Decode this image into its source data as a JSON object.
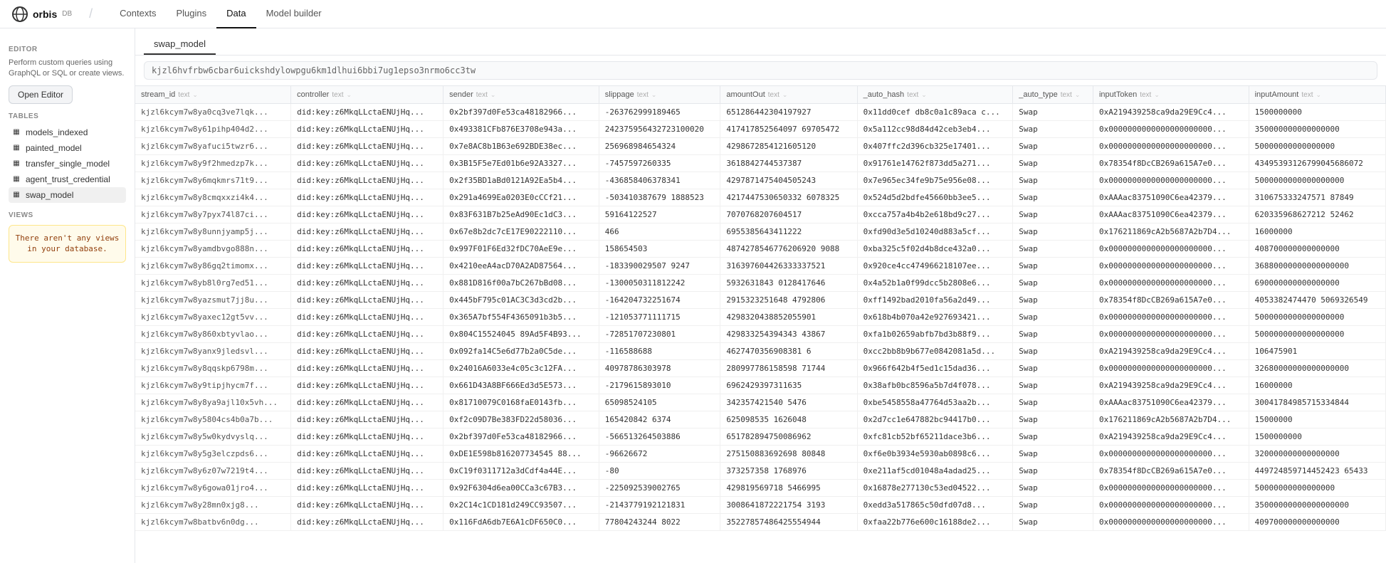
{
  "logo": {
    "text": "orbis",
    "db": "DB"
  },
  "nav": {
    "items": [
      {
        "label": "Contexts",
        "active": false
      },
      {
        "label": "Plugins",
        "active": false
      },
      {
        "label": "Data",
        "active": true
      },
      {
        "label": "Model builder",
        "active": false
      }
    ]
  },
  "sidebar": {
    "editor_section": "EDITOR",
    "editor_desc": "Perform custom queries using GraphQL or SQL or create views.",
    "editor_btn": "Open Editor",
    "tables_section": "TABLES",
    "tables": [
      {
        "label": "models_indexed",
        "icon": "📋"
      },
      {
        "label": "painted_model",
        "icon": "📋"
      },
      {
        "label": "transfer_single_model",
        "icon": "📋"
      },
      {
        "label": "agent_trust_credential",
        "icon": "📋"
      },
      {
        "label": "swap_model",
        "icon": "📋",
        "active": true
      }
    ],
    "views_section": "VIEWS",
    "views_empty": "There aren't any views\nin your database."
  },
  "tab": {
    "label": "swap_model",
    "query": "kjzl6hvfrbw6cbar6uickshdylowpgu6km1dlhui6bbi7ug1epso3nrmo6cc3tw"
  },
  "columns": [
    {
      "label": "stream_id",
      "type": "text"
    },
    {
      "label": "controller",
      "type": "text"
    },
    {
      "label": "sender",
      "type": "text"
    },
    {
      "label": "slippage",
      "type": "text"
    },
    {
      "label": "amountOut",
      "type": "text"
    },
    {
      "label": "_auto_hash",
      "type": "text"
    },
    {
      "label": "_auto_type",
      "type": "text"
    },
    {
      "label": "inputToken",
      "type": "text"
    },
    {
      "label": "inputAmount",
      "type": "text"
    }
  ],
  "rows": [
    {
      "stream_id": "kjzl6kcym7w8ya0cq3ve7lqk...",
      "controller": "did:key:z6MkqLLctaENUjHq...",
      "sender": "0x2bf397d0Fe53ca48182966...",
      "slippage": "-263762999189465",
      "amountOut": "651286442304197927",
      "auto_hash": "0x11dd0cef db8c0a1c89aca c...",
      "auto_type": "Swap",
      "inputToken": "0xA219439258ca9da29E9Cc4...",
      "inputAmount": "1500000000"
    },
    {
      "stream_id": "kjzl6kcym7w8y61pihp404d2...",
      "controller": "did:key:z6MkqLLctaENUjHq...",
      "sender": "0x493381CFb876E3708e943a...",
      "slippage": "242375956432723100020",
      "amountOut": "417417852564097 69705472",
      "auto_hash": "0x5a112cc98d84d42ceb3eb4...",
      "auto_type": "Swap",
      "inputToken": "0x0000000000000000000000...",
      "inputAmount": "350000000000000000"
    },
    {
      "stream_id": "kjzl6kcym7w8yafuci5twzr6...",
      "controller": "did:key:z6MkqLLctaENUjHq...",
      "sender": "0x7e8AC8b1B63e692BDE38ec...",
      "slippage": "256968984654324",
      "amountOut": "4298672854121605120",
      "auto_hash": "0x407ffc2d396cb325e17401...",
      "auto_type": "Swap",
      "inputToken": "0x0000000000000000000000...",
      "inputAmount": "50000000000000000"
    },
    {
      "stream_id": "kjzl6kcym7w8y9f2hmedzp7k...",
      "controller": "did:key:z6MkqLLctaENUjHq...",
      "sender": "0x3B15F5e7Ed01b6e92A3327...",
      "slippage": "-7457597260335",
      "amountOut": "3618842744537387",
      "auto_hash": "0x91761e14762f873dd5a271...",
      "auto_type": "Swap",
      "inputToken": "0x78354f8DcCB269a615A7e0...",
      "inputAmount": "43495393126799045686072"
    },
    {
      "stream_id": "kjzl6kcym7w8y6mqkmrs71t9...",
      "controller": "did:key:z6MkqLLctaENUjHq...",
      "sender": "0x2f35BD1aBd0121A92Ea5b4...",
      "slippage": "-436858406378341",
      "amountOut": "4297871475404505243",
      "auto_hash": "0x7e965ec34fe9b75e956e08...",
      "auto_type": "Swap",
      "inputToken": "0x0000000000000000000000...",
      "inputAmount": "5000000000000000000"
    },
    {
      "stream_id": "kjzl6kcym7w8y8cmqxxzi4k4...",
      "controller": "did:key:z6MkqLLctaENUjHq...",
      "sender": "0x291a4699Ea0203E0cCCf21...",
      "slippage": "-503410387679 1888523",
      "amountOut": "4217447530650332 6078325",
      "auto_hash": "0x524d5d2bdfe45660bb3ee5...",
      "auto_type": "Swap",
      "inputToken": "0xAAAac83751090C6ea42379...",
      "inputAmount": "310675333247571 87849"
    },
    {
      "stream_id": "kjzl6kcym7w8y7pyx74l87ci...",
      "controller": "did:key:z6MkqLLctaENUjHq...",
      "sender": "0x83F631B7b25eAd90Ec1dC3...",
      "slippage": "59164122527",
      "amountOut": "7070768207604517",
      "auto_hash": "0xcca757a4b4b2e618bd9c27...",
      "auto_type": "Swap",
      "inputToken": "0xAAAac83751090C6ea42379...",
      "inputAmount": "620335968627212 52462"
    },
    {
      "stream_id": "kjzl6kcym7w8y8unnjyamp5j...",
      "controller": "did:key:z6MkqLLctaENUjHq...",
      "sender": "0x67e8b2dc7cE17E90222110...",
      "slippage": "466",
      "amountOut": "6955385643411222",
      "auto_hash": "0xfd90d3e5d10240d883a5cf...",
      "auto_type": "Swap",
      "inputToken": "0x176211869cA2b5687A2b7D4...",
      "inputAmount": "16000000"
    },
    {
      "stream_id": "kjzl6kcym7w8yamdbvgo888n...",
      "controller": "did:key:z6MkqLLctaENUjHq...",
      "sender": "0x997F01F6Ed32fDC70AeE9e...",
      "slippage": "158654503",
      "amountOut": "4874278546776206920 9088",
      "auto_hash": "0xba325c5f02d4b8dce432a0...",
      "auto_type": "Swap",
      "inputToken": "0x0000000000000000000000...",
      "inputAmount": "408700000000000000"
    },
    {
      "stream_id": "kjzl6kcym7w8y86gq2timomx...",
      "controller": "did:key:z6MkqLLctaENUjHq...",
      "sender": "0x4210eeA4acD70A2AD87564...",
      "slippage": "-183390029507 9247",
      "amountOut": "316397604426333337521",
      "auto_hash": "0x920ce4cc474966218107ee...",
      "auto_type": "Swap",
      "inputToken": "0x0000000000000000000000...",
      "inputAmount": "36880000000000000000"
    },
    {
      "stream_id": "kjzl6kcym7w8yb8l0rg7ed51...",
      "controller": "did:key:z6MkqLLctaENUjHq...",
      "sender": "0x881D816f00a7bC267bBd08...",
      "slippage": "-1300050311812242",
      "amountOut": "5932631843 0128417646",
      "auto_hash": "0x4a52b1a0f99dcc5b2808e6...",
      "auto_type": "Swap",
      "inputToken": "0x0000000000000000000000...",
      "inputAmount": "690000000000000000"
    },
    {
      "stream_id": "kjzl6kcym7w8yazsmut7jj8u...",
      "controller": "did:key:z6MkqLLctaENUjHq...",
      "sender": "0x445bF795c01AC3C3d3cd2b...",
      "slippage": "-164204732251674",
      "amountOut": "2915323251648 4792806",
      "auto_hash": "0xff1492bad2010fa56a2d49...",
      "auto_type": "Swap",
      "inputToken": "0x78354f8DcCB269a615A7e0...",
      "inputAmount": "4053382474470 5069326549"
    },
    {
      "stream_id": "kjzl6kcym7w8yaxec12gt5vv...",
      "controller": "did:key:z6MkqLLctaENUjHq...",
      "sender": "0x365A7bf554F4365091b3b5...",
      "slippage": "-121053771111715",
      "amountOut": "4298320438852055901",
      "auto_hash": "0x618b4b070a42e927693421...",
      "auto_type": "Swap",
      "inputToken": "0x0000000000000000000000...",
      "inputAmount": "5000000000000000000"
    },
    {
      "stream_id": "kjzl6kcym7w8y860xbtyvlao...",
      "controller": "did:key:z6MkqLLctaENUjHq...",
      "sender": "0x804C15524045 89Ad5F4B93...",
      "slippage": "-72851707230801",
      "amountOut": "429833254394343 43867",
      "auto_hash": "0xfa1b02659abfb7bd3b88f9...",
      "auto_type": "Swap",
      "inputToken": "0x0000000000000000000000...",
      "inputAmount": "5000000000000000000"
    },
    {
      "stream_id": "kjzl6kcym7w8yanx9jledsvl...",
      "controller": "did:key:z6MkqLLctaENUjHq...",
      "sender": "0x092fa14C5e6d77b2a0C5de...",
      "slippage": "-116588688",
      "amountOut": "4627470356908381 6",
      "auto_hash": "0xcc2bb8b9b677e0842081a5d...",
      "auto_type": "Swap",
      "inputToken": "0xA219439258ca9da29E9Cc4...",
      "inputAmount": "106475901"
    },
    {
      "stream_id": "kjzl6kcym7w8y8qqskp6798m...",
      "controller": "did:key:z6MkqLLctaENUjHq...",
      "sender": "0x24016A6033e4c05c3c12FA...",
      "slippage": "40978786303978",
      "amountOut": "280997786158598 71744",
      "auto_hash": "0x966f642b4f5ed1c15dad36...",
      "auto_type": "Swap",
      "inputToken": "0x0000000000000000000000...",
      "inputAmount": "32680000000000000000"
    },
    {
      "stream_id": "kjzl6kcym7w8y9tipjhycm7f...",
      "controller": "did:key:z6MkqLLctaENUjHq...",
      "sender": "0x661D43A8BF666Ed3d5E573...",
      "slippage": "-2179615893010",
      "amountOut": "6962429397311635",
      "auto_hash": "0x38afb0bc8596a5b7d4f078...",
      "auto_type": "Swap",
      "inputToken": "0xA219439258ca9da29E9Cc4...",
      "inputAmount": "16000000"
    },
    {
      "stream_id": "kjzl6kcym7w8y8ya9ajl10x5vh...",
      "controller": "did:key:z6MkqLLctaENUjHq...",
      "sender": "0x81710079C0168faE0143fb...",
      "slippage": "65098524105",
      "amountOut": "342357421540 5476",
      "auto_hash": "0xbe5458558a47764d53aa2b...",
      "auto_type": "Swap",
      "inputToken": "0xAAAac83751090C6ea42379...",
      "inputAmount": "30041784985715334844"
    },
    {
      "stream_id": "kjzl6kcym7w8y5804cs4b0a7b...",
      "controller": "did:key:z6MkqLLctaENUjHq...",
      "sender": "0xf2c09D7Be383FD22d58036...",
      "slippage": "165420842 6374",
      "amountOut": "625098535 1626048",
      "auto_hash": "0x2d7cc1e647882bc94417b0...",
      "auto_type": "Swap",
      "inputToken": "0x176211869cA2b5687A2b7D4...",
      "inputAmount": "15000000"
    },
    {
      "stream_id": "kjzl6kcym7w8y5w0kydvyslq...",
      "controller": "did:key:z6MkqLLctaENUjHq...",
      "sender": "0x2bf397d0Fe53ca48182966...",
      "slippage": "-566513264503886",
      "amountOut": "651782894750086962",
      "auto_hash": "0xfc81cb52bf65211dace3b6...",
      "auto_type": "Swap",
      "inputToken": "0xA219439258ca9da29E9Cc4...",
      "inputAmount": "1500000000"
    },
    {
      "stream_id": "kjzl6kcym7w8y5g3elczpds6...",
      "controller": "did:key:z6MkqLLctaENUjHq...",
      "sender": "0xDE1E598b816207734545 88...",
      "slippage": "-96626672",
      "amountOut": "275150883692698 80848",
      "auto_hash": "0xf6e0b3934e5930ab0898c6...",
      "auto_type": "Swap",
      "inputToken": "0x0000000000000000000000...",
      "inputAmount": "320000000000000000"
    },
    {
      "stream_id": "kjzl6kcym7w8y6z07w7219t4...",
      "controller": "did:key:z6MkqLLctaENUjHq...",
      "sender": "0xC19f0311712a3dCdf4a44E...",
      "slippage": "-80",
      "amountOut": "373257358 1768976",
      "auto_hash": "0xe211af5cd01048a4adad25...",
      "auto_type": "Swap",
      "inputToken": "0x78354f8DcCB269a615A7e0...",
      "inputAmount": "449724859714452423 65433"
    },
    {
      "stream_id": "kjzl6kcym7w8y6gowa01jro4...",
      "controller": "did:key:z6MkqLLctaENUjHq...",
      "sender": "0x92F6304d6ea00CCa3c67B3...",
      "slippage": "-225092539002765",
      "amountOut": "429819569718 5466995",
      "auto_hash": "0x16878e277130c53ed04522...",
      "auto_type": "Swap",
      "inputToken": "0x0000000000000000000000...",
      "inputAmount": "50000000000000000"
    },
    {
      "stream_id": "kjzl6kcym7w8y28mn0xjg8...",
      "controller": "did:key:z6MkqLLctaENUjHq...",
      "sender": "0x2C14c1CD181d249CC93507...",
      "slippage": "-2143779192121831",
      "amountOut": "3008641872221754 3193",
      "auto_hash": "0xedd3a517865c50dfd07d8...",
      "auto_type": "Swap",
      "inputToken": "0x0000000000000000000000...",
      "inputAmount": "35000000000000000000"
    },
    {
      "stream_id": "kjzl6kcym7w8batbv6n0dg...",
      "controller": "did:key:z6MkqLLctaENUjHq...",
      "sender": "0x116FdA6db7E6A1cDF650C0...",
      "slippage": "77804243244 8022",
      "amountOut": "35227857486425554944",
      "auto_hash": "0xfaa22b776e600c16188de2...",
      "auto_type": "Swap",
      "inputToken": "0x0000000000000000000000...",
      "inputAmount": "409700000000000000"
    }
  ]
}
